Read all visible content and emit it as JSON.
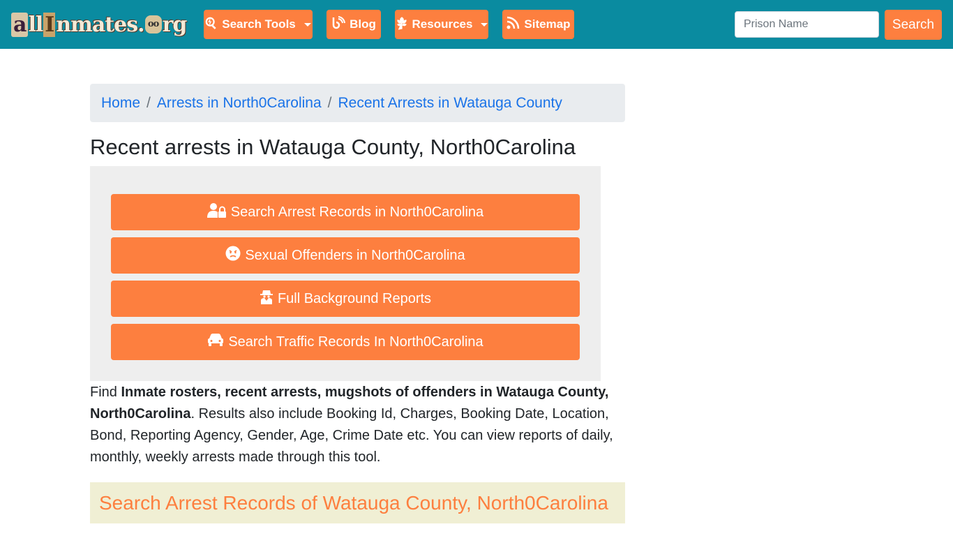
{
  "navbar": {
    "logo": {
      "part_a": "a",
      "part_ll": "ll",
      "part_i": "I",
      "part_nmates": "nmates.",
      "part_o": "oo",
      "part_rg": "rg"
    },
    "items": [
      {
        "label": "Search Tools",
        "icon": "search-tools-icon",
        "dropdown": true
      },
      {
        "label": "Blog",
        "icon": "blog-icon",
        "dropdown": false
      },
      {
        "label": "Resources",
        "icon": "leaf-icon",
        "dropdown": true
      },
      {
        "label": "Sitemap",
        "icon": "rss-icon",
        "dropdown": false
      }
    ],
    "search": {
      "placeholder": "Prison Name",
      "value": "",
      "button_label": "Search"
    }
  },
  "breadcrumb": [
    {
      "label": "Home"
    },
    {
      "label": "Arrests in North0Carolina"
    },
    {
      "label": "Recent Arrests in Watauga County"
    }
  ],
  "breadcrumb_separator": "/",
  "page_title": "Recent arrests in Watauga County, North0Carolina",
  "panel_buttons": [
    {
      "label": "Search Arrest Records in North0Carolina",
      "icon": "user-lock-icon"
    },
    {
      "label": "Sexual Offenders in North0Carolina",
      "icon": "angry-face-icon"
    },
    {
      "label": "Full Background Reports",
      "icon": "user-secret-icon"
    },
    {
      "label": "Search Traffic Records In North0Carolina",
      "icon": "car-icon"
    }
  ],
  "description": {
    "prefix": "Find ",
    "bold": "Inmate rosters, recent arrests, mugshots of offenders in Watauga County, North0Carolina",
    "suffix": ". Results also include Booking Id, Charges, Booking Date, Location, Bond, Reporting Agency, Gender, Age, Crime Date etc. You can view reports of daily, monthly, weekly arrests made through this tool."
  },
  "section_heading": "Search Arrest Records of Watauga County, North0Carolina",
  "colors": {
    "navbar_bg": "#0a8ba0",
    "accent_orange": "#fd7f3f",
    "link_blue": "#1a73e8",
    "breadcrumb_bg": "#e9ecef",
    "panel_bg": "#eeeeee",
    "section_heading_bg": "#f0efd4"
  }
}
